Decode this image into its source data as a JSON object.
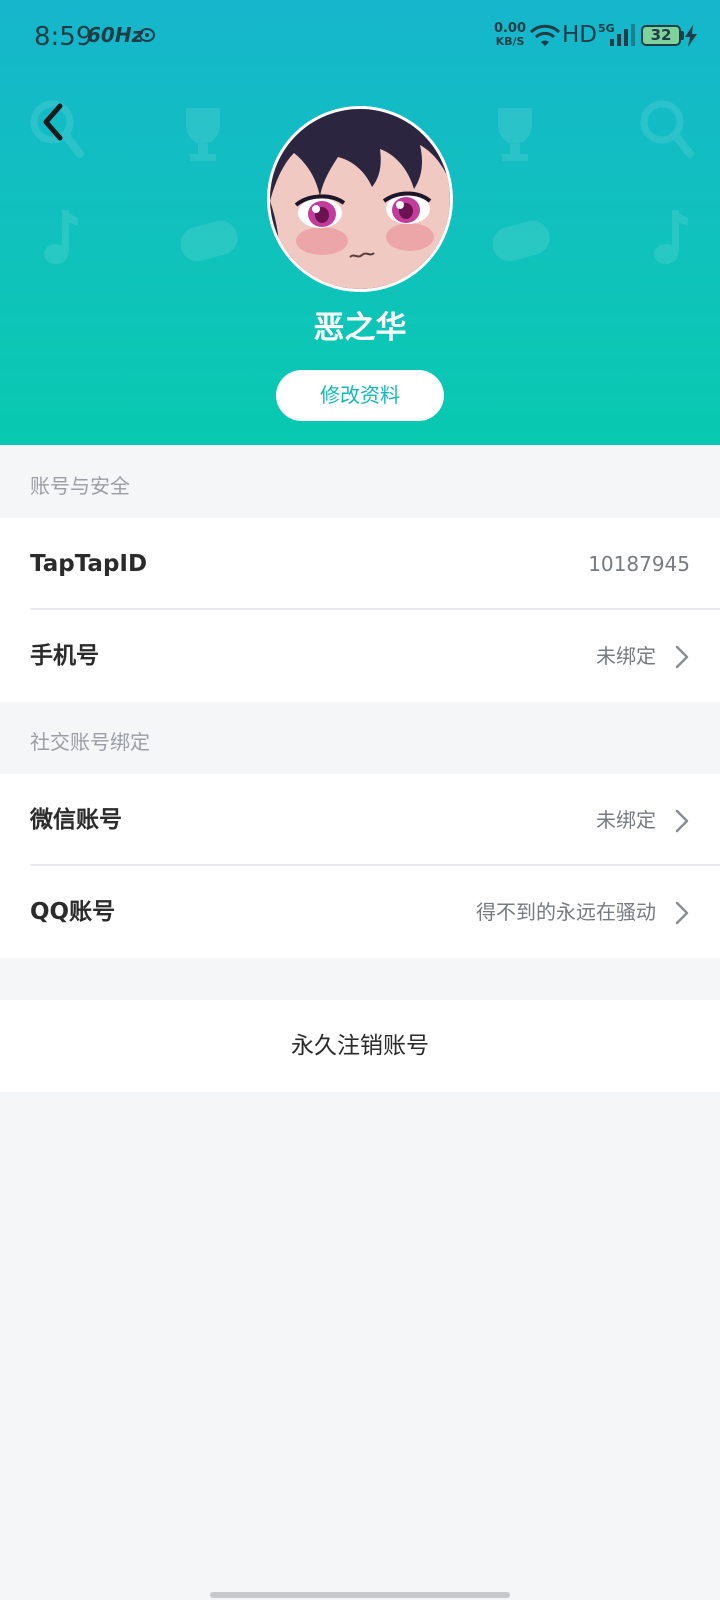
{
  "status_bar": {
    "time": "8:59",
    "refresh_rate": "60Hz",
    "net_speed_value": "0.00",
    "net_speed_unit": "KB/S",
    "hd": "HD",
    "network_type": "5G",
    "battery": "32"
  },
  "profile": {
    "username": "恶之华",
    "edit_button": "修改资料"
  },
  "sections": {
    "account_security": {
      "title": "账号与安全",
      "taptap_id_label": "TapTapID",
      "taptap_id_value": "10187945",
      "phone_label": "手机号",
      "phone_value": "未绑定"
    },
    "social_binding": {
      "title": "社交账号绑定",
      "wechat_label": "微信账号",
      "wechat_value": "未绑定",
      "qq_label": "QQ账号",
      "qq_value": "得不到的永远在骚动"
    }
  },
  "delete_account": "永久注销账号",
  "colors": {
    "header_top": "#16b6cc",
    "header_bottom": "#08c9b0",
    "accent": "#14b8b8",
    "background": "#f5f6f8"
  },
  "icons": [
    "back-arrow-icon",
    "chevron-right-icon",
    "wifi-icon",
    "signal-icon",
    "charging-icon"
  ]
}
